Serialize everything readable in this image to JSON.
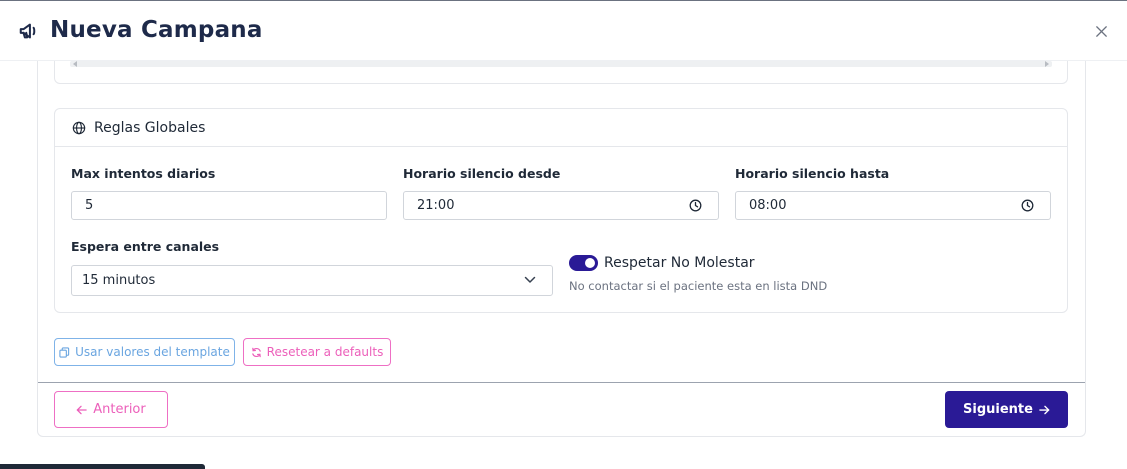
{
  "header": {
    "title": "Nueva Campana",
    "title_icon": "megaphone-icon",
    "close_icon": "close-icon"
  },
  "global_rules": {
    "title": "Reglas Globales",
    "icon": "globe-icon",
    "max_attempts": {
      "label": "Max intentos diarios",
      "value": "5"
    },
    "quiet_from": {
      "label": "Horario silencio desde",
      "value": "21:00"
    },
    "quiet_to": {
      "label": "Horario silencio hasta",
      "value": "08:00"
    },
    "channel_wait": {
      "label": "Espera entre canales",
      "value": "15 minutos"
    },
    "dnd": {
      "label": "Respetar No Molestar",
      "help": "No contactar si el paciente esta en lista DND",
      "enabled": true
    }
  },
  "actions": {
    "use_template": "Usar valores del template",
    "reset_defaults": "Resetear a defaults"
  },
  "footer": {
    "prev": "Anterior",
    "next": "Siguiente"
  },
  "colors": {
    "primary": "#2a1a96",
    "pink": "#ec5fba",
    "blue": "#6aa5e0",
    "title": "#1e2a4a"
  }
}
